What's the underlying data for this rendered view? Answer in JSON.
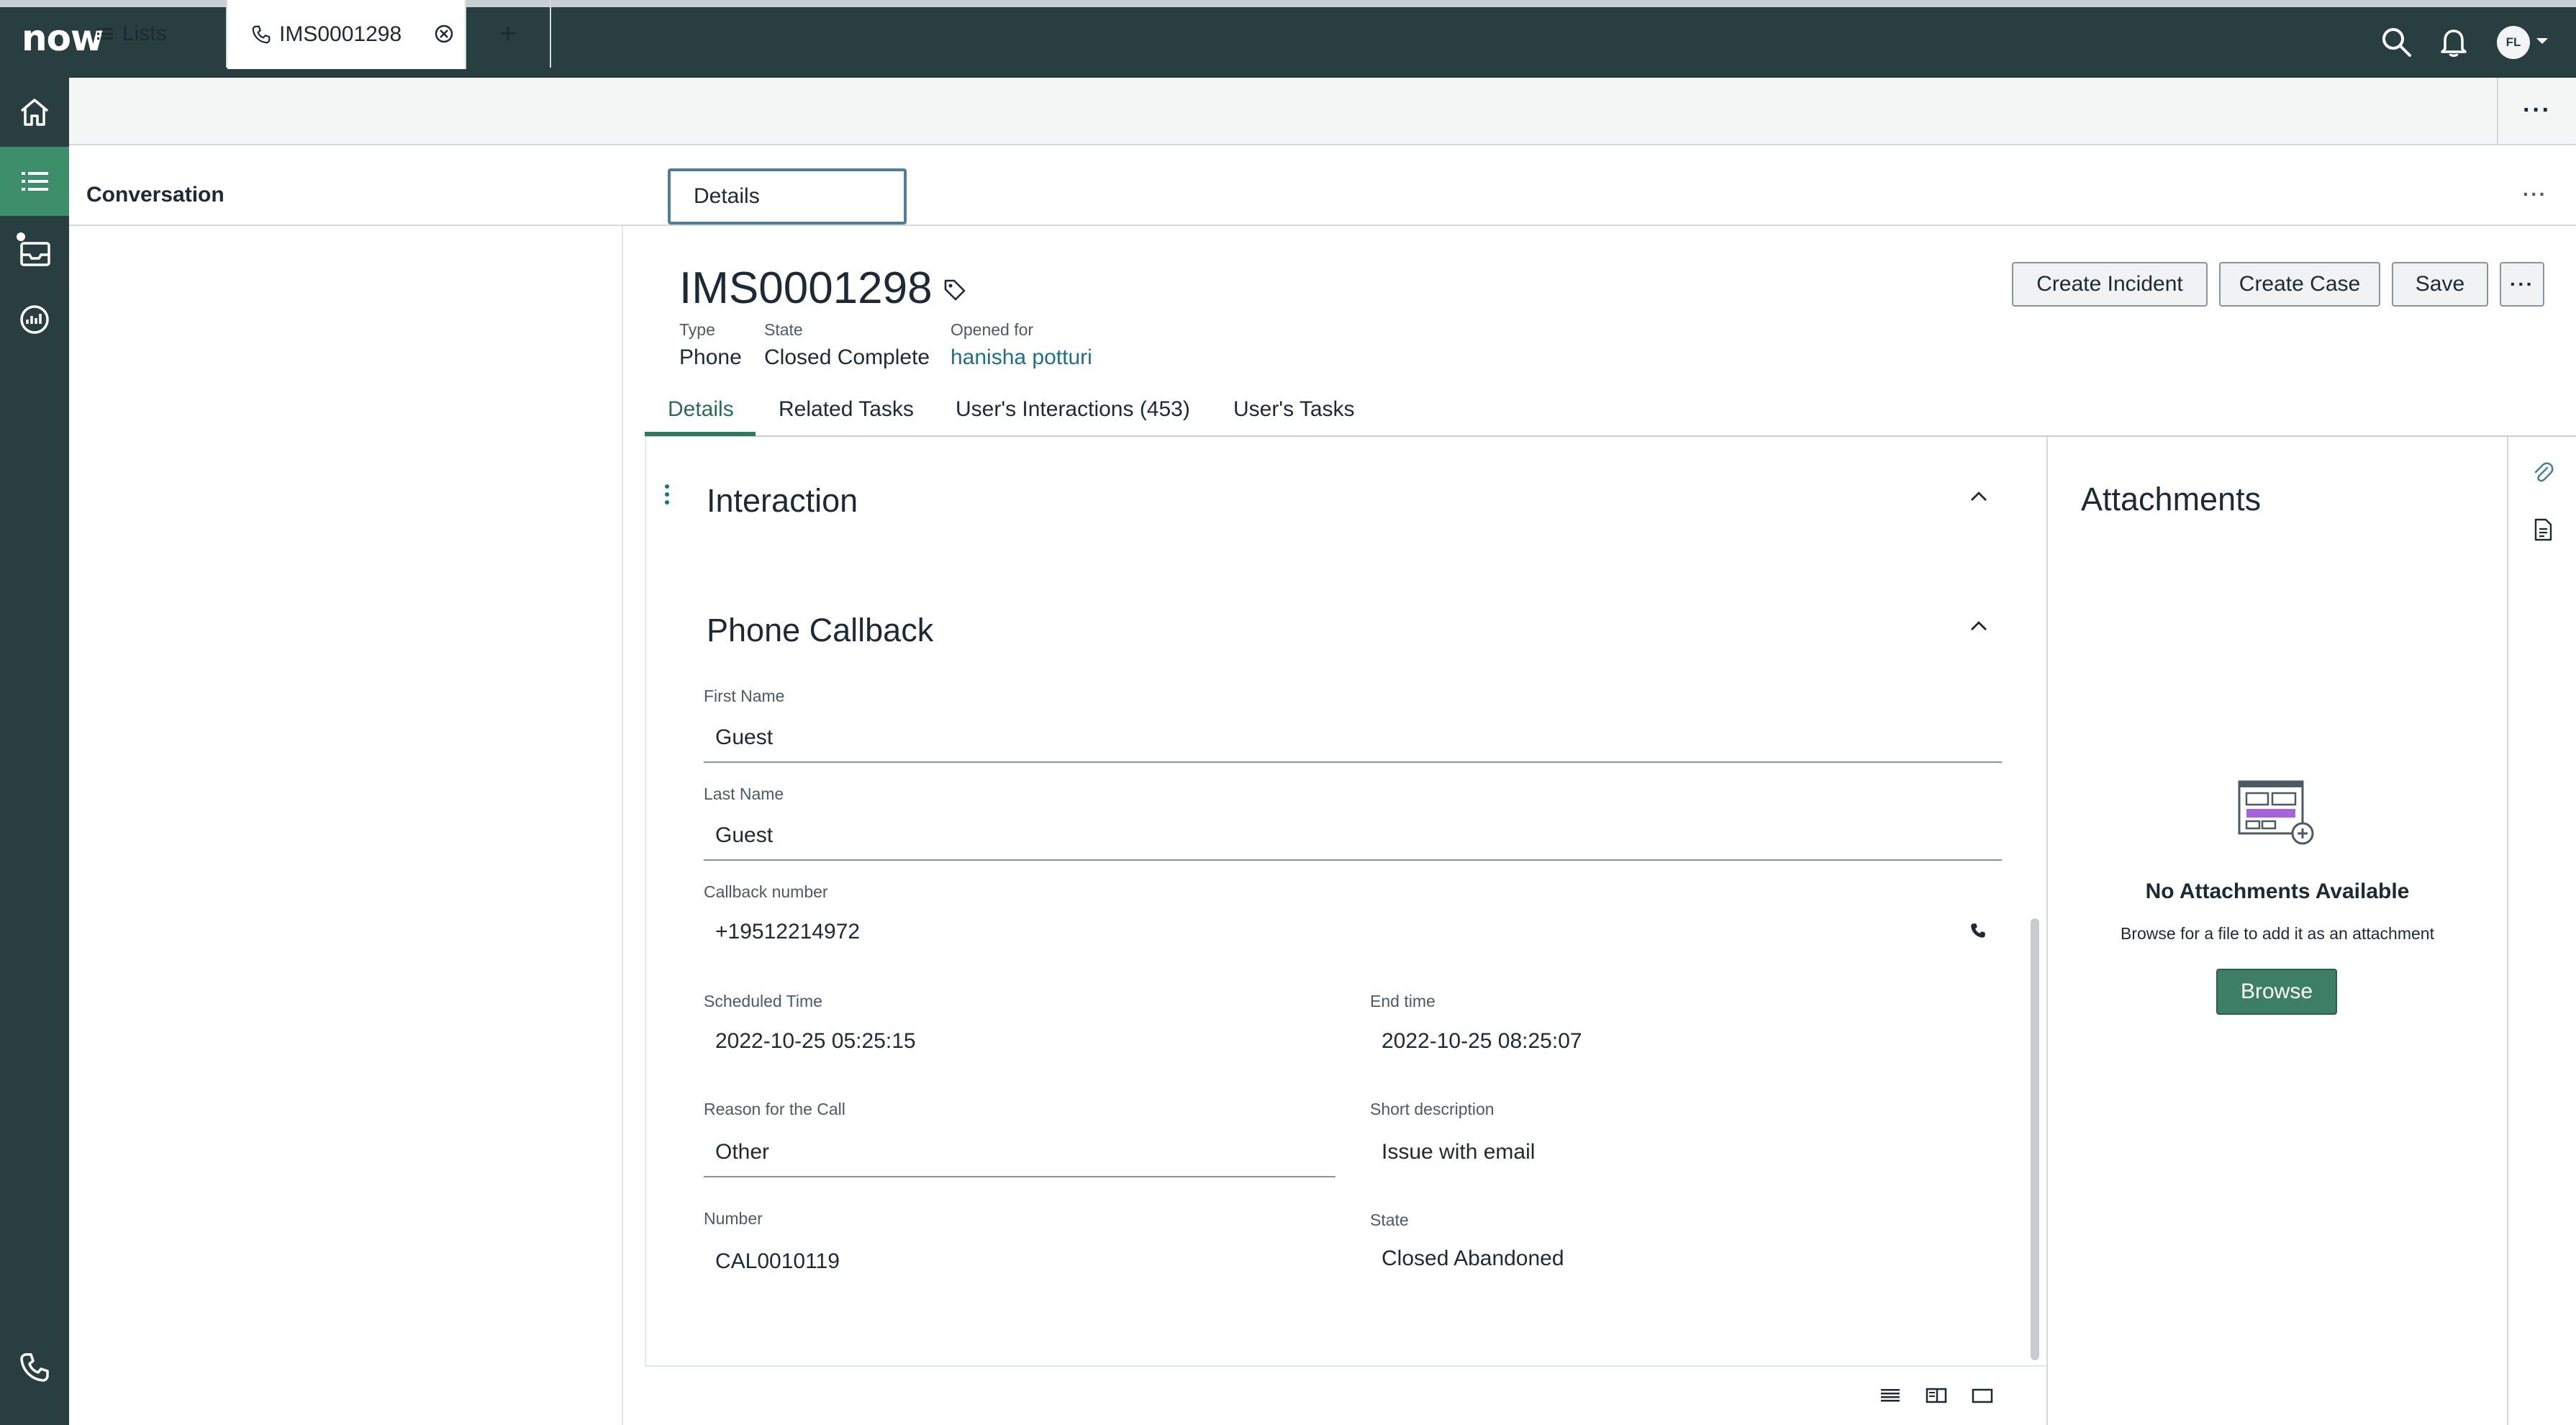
{
  "app": {
    "logo": "now",
    "avatar_initials": "FL"
  },
  "tabs": {
    "lists_label": "Lists",
    "record_label": "IMS0001298",
    "add_label": "+"
  },
  "workspace": {
    "conversation_title": "Conversation",
    "details_tab": "Details"
  },
  "record": {
    "number": "IMS0001298",
    "type_label": "Type",
    "type_value": "Phone",
    "state_label": "State",
    "state_value": "Closed Complete",
    "opened_for_label": "Opened for",
    "opened_for_value": "hanisha potturi",
    "actions": {
      "create_incident": "Create Incident",
      "create_case": "Create Case",
      "save": "Save"
    },
    "subtabs": {
      "details": "Details",
      "related_tasks": "Related Tasks",
      "interactions": "User's Interactions (453)",
      "user_tasks": "User's Tasks"
    }
  },
  "form": {
    "interaction_title": "Interaction",
    "callback_title": "Phone Callback",
    "first_name_label": "First Name",
    "first_name_value": "Guest",
    "last_name_label": "Last Name",
    "last_name_value": "Guest",
    "callback_number_label": "Callback number",
    "callback_number_value": "+19512214972",
    "scheduled_time_label": "Scheduled Time",
    "scheduled_time_value": "2022-10-25 05:25:15",
    "end_time_label": "End time",
    "end_time_value": "2022-10-25 08:25:07",
    "reason_label": "Reason for the Call",
    "reason_value": "Other",
    "short_desc_label": "Short description",
    "short_desc_value": "Issue with email",
    "number_label": "Number",
    "number_value": "CAL0010119",
    "state_label": "State",
    "state_value": "Closed Abandoned"
  },
  "attachments": {
    "title": "Attachments",
    "empty_title": "No Attachments Available",
    "empty_hint": "Browse for a file to add it as an attachment",
    "browse_label": "Browse"
  },
  "colors": {
    "topbar": "#293e40",
    "accent": "#3d8e6a",
    "link": "#1f6e8c"
  }
}
